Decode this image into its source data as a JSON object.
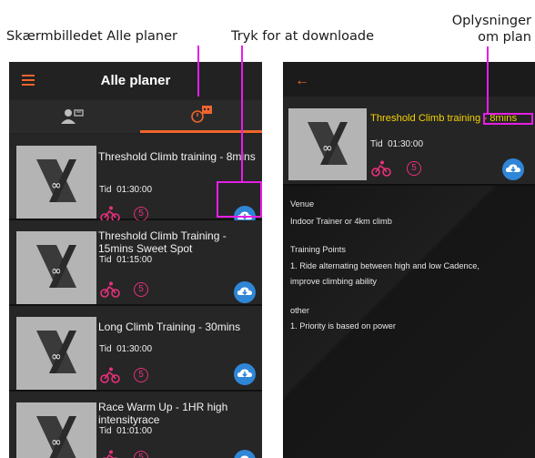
{
  "captions": {
    "left": "Skærmbilledet Alle planer",
    "middle": "Tryk for at downloade",
    "right_line1": "Oplysninger",
    "right_line2": "om plan"
  },
  "list_screen": {
    "title": "Alle planer",
    "tabs": [
      "people-settings-icon",
      "calendar-icon"
    ],
    "items": [
      {
        "title": "Threshold Climb training - 8mins",
        "time_label": "Tid",
        "time": "01:30:00",
        "badge": "5"
      },
      {
        "title": "Threshold Climb Training - 15mins Sweet Spot",
        "time_label": "Tid",
        "time": "01:15:00",
        "badge": "5"
      },
      {
        "title": "Long Climb Training - 30mins",
        "time_label": "Tid",
        "time": "01:30:00",
        "badge": "5"
      },
      {
        "title": "Race Warm Up - 1HR high intensityrace",
        "time_label": "Tid",
        "time": "01:01:00",
        "badge": "5"
      }
    ]
  },
  "detail_screen": {
    "title": "Threshold Climb training - 8mins",
    "time_label": "Tid",
    "time": "01:30:00",
    "badge": "5",
    "venue_heading": "Venue",
    "venue": "Indoor Trainer or 4km climb",
    "points_heading": "Training Points",
    "points_line1": "1. Ride alternating between high and low Cadence,",
    "points_line2": "improve climbing ability",
    "other_heading": "other",
    "other_line1": "1. Priority is based on power"
  },
  "colors": {
    "accent": "#f0652d",
    "highlight": "#e61ee6",
    "title_yellow": "#f3d200",
    "download_blue": "#2f86d6",
    "badge_pink": "#e8307c"
  }
}
